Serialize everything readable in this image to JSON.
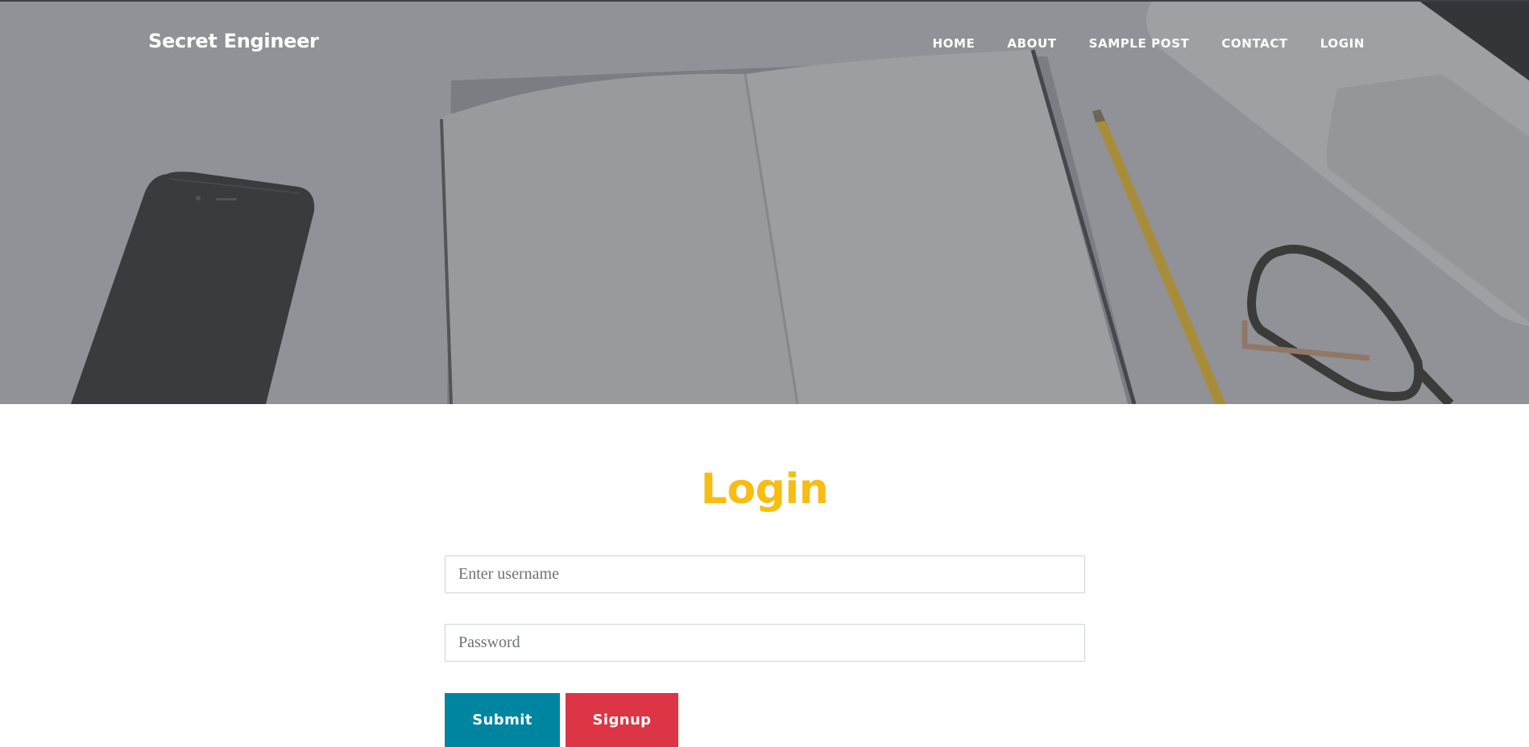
{
  "brand": {
    "name": "Secret Engineer"
  },
  "nav": {
    "items": [
      {
        "label": "HOME"
      },
      {
        "label": "ABOUT"
      },
      {
        "label": "SAMPLE POST"
      },
      {
        "label": "CONTACT"
      },
      {
        "label": "LOGIN"
      }
    ]
  },
  "login": {
    "heading": "Login",
    "username_placeholder": "Enter username",
    "password_placeholder": "Password",
    "submit_label": "Submit",
    "signup_label": "Signup"
  },
  "colors": {
    "heading": "#f7bd12",
    "submit": "#0085a1",
    "signup": "#dc3545",
    "hero_overlay": "#7d7f84"
  }
}
